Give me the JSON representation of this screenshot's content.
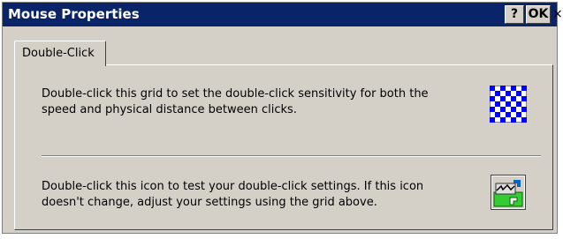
{
  "window": {
    "title": "Mouse Properties",
    "help_label": "?",
    "ok_label": "OK",
    "close_label": "×"
  },
  "tabs": [
    {
      "label": "Double-Click",
      "selected": true
    }
  ],
  "panel": {
    "grid_description": "Double-click this grid to set the double-click sensitivity for both the speed and physical distance between clicks.",
    "grid_icon": "checkerboard-grid-icon",
    "test_description": "Double-click this icon to test your double-click settings. If this icon doesn't change, adjust your settings using the grid above.",
    "test_icon": "test-double-click-icon"
  },
  "colors": {
    "titlebar": "#0a246a",
    "window_bg": "#d4d0c8",
    "grid_blue": "#0000ff",
    "icon_green": "#33cc33"
  }
}
